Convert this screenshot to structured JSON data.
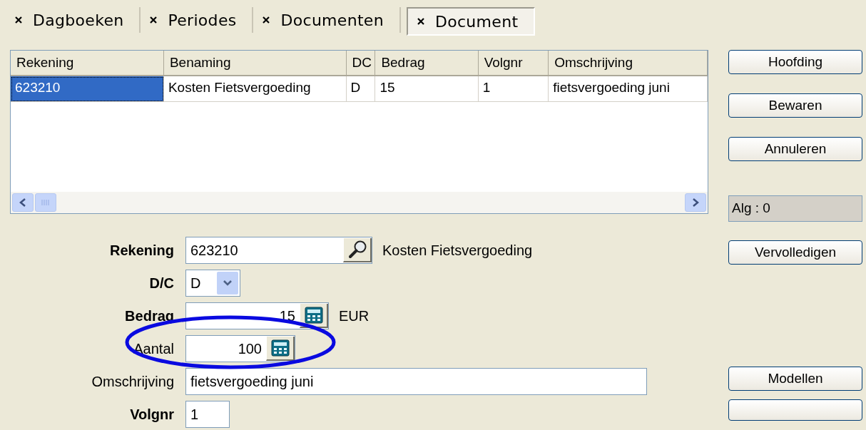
{
  "tabs": [
    {
      "label": "Dagboeken",
      "selected": false
    },
    {
      "label": "Periodes",
      "selected": false
    },
    {
      "label": "Documenten",
      "selected": false
    },
    {
      "label": "Document",
      "selected": true
    }
  ],
  "table": {
    "columns": [
      "Rekening",
      "Benaming",
      "DC",
      "Bedrag",
      "Volgnr",
      "Omschrijving"
    ],
    "rows": [
      {
        "cells": [
          {
            "text": "623210",
            "selected": true
          },
          {
            "text": "Kosten Fietsvergoeding",
            "selected": false
          },
          {
            "text": "D",
            "selected": false
          },
          {
            "text": "15",
            "selected": false
          },
          {
            "text": "1",
            "selected": false
          },
          {
            "text": "fietsvergoeding juni",
            "selected": false
          }
        ]
      }
    ]
  },
  "form": [
    {
      "kind": "lookup",
      "label": "Rekening",
      "bold": true,
      "value": "623210",
      "description": "Kosten Fietsvergoeding"
    },
    {
      "kind": "select",
      "label": "D/C",
      "bold": true,
      "value": "D"
    },
    {
      "kind": "calc",
      "label": "Bedrag",
      "bold": true,
      "value": "15",
      "unit": "EUR"
    },
    {
      "kind": "calc",
      "label": "Aantal",
      "bold": false,
      "value": "100"
    },
    {
      "kind": "text",
      "label": "Omschrijving",
      "bold": false,
      "value": "fietsvergoeding juni"
    },
    {
      "kind": "short",
      "label": "Volgnr",
      "bold": true,
      "value": "1"
    }
  ],
  "right_panel": {
    "buttons_top": [
      "Hoofding",
      "Bewaren",
      "Annuleren"
    ],
    "status": "Alg : 0",
    "buttons_middle": [
      "Vervolledigen"
    ],
    "buttons_bottom": [
      "Modellen"
    ]
  }
}
